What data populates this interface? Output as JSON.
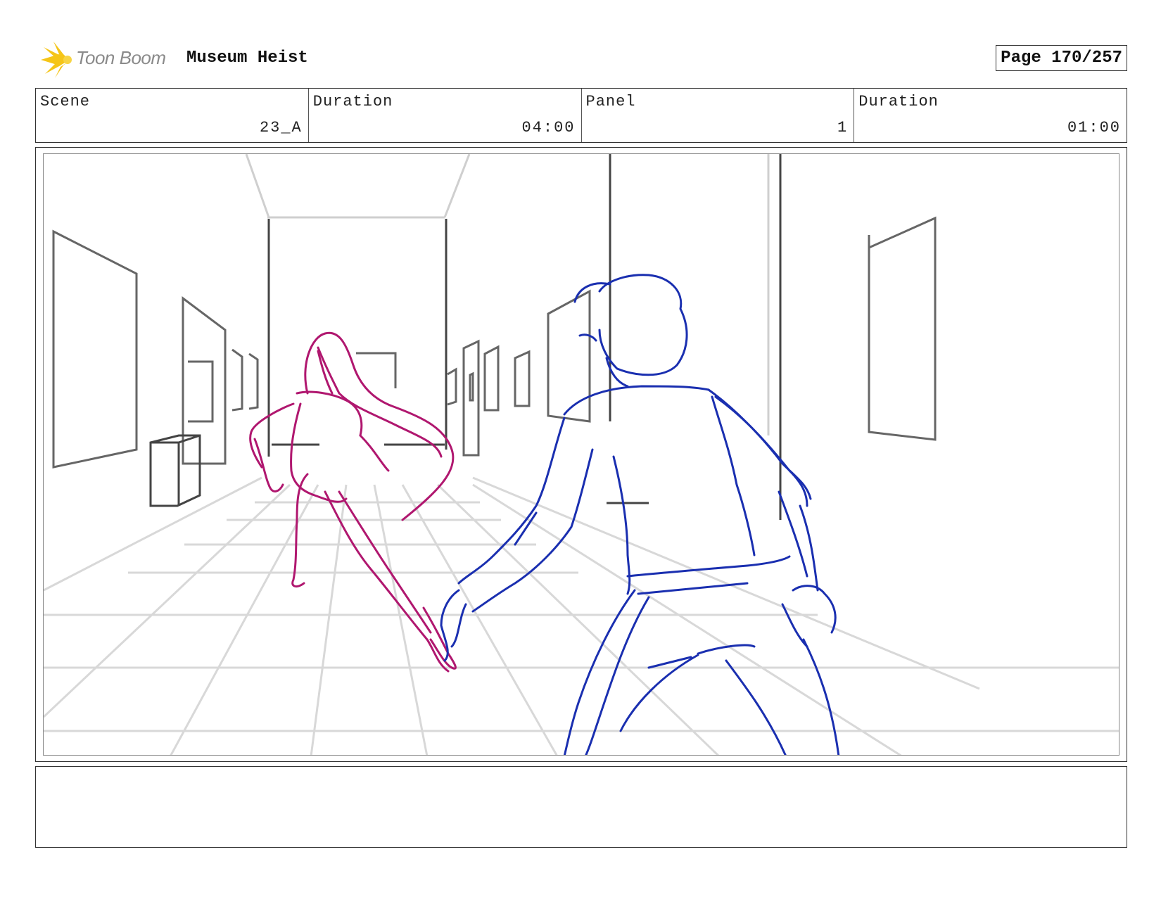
{
  "header": {
    "logo_text": "Toon Boom",
    "project_title": "Museum Heist",
    "page_label": "Page 170/257"
  },
  "info": {
    "scene_label": "Scene",
    "scene_value": "23_A",
    "scene_duration_label": "Duration",
    "scene_duration_value": "04:00",
    "panel_label": "Panel",
    "panel_value": "1",
    "panel_duration_label": "Duration",
    "panel_duration_value": "01:00"
  },
  "colors": {
    "logo_accent": "#f5c518",
    "girl_sketch": "#b0176f",
    "man_sketch": "#1a2fb0",
    "set_lines": "#555555",
    "floor_grid": "#d8d8d8"
  },
  "notes": {
    "text": ""
  }
}
